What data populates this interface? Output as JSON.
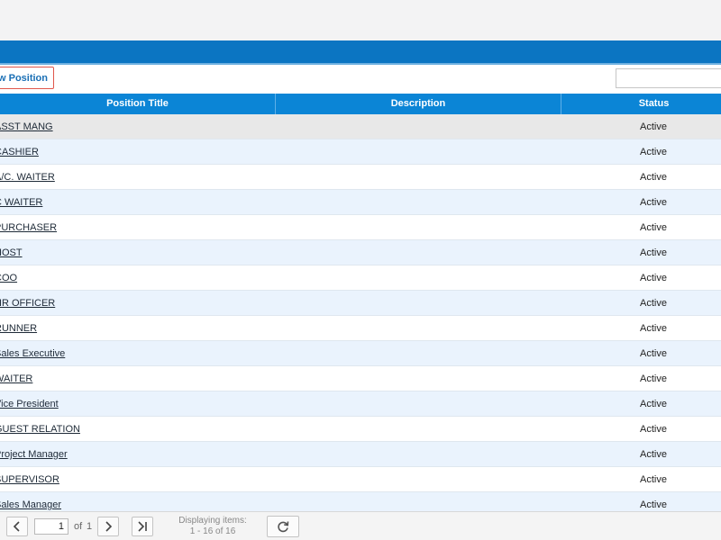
{
  "toolbar": {
    "new_position_label": "New Position"
  },
  "search": {
    "value": "",
    "placeholder": ""
  },
  "grid": {
    "columns": [
      "Position Title",
      "Description",
      "Status"
    ],
    "rows": [
      {
        "title": "ASST MANG",
        "description": "",
        "status": "Active"
      },
      {
        "title": "CASHIER",
        "description": "",
        "status": "Active"
      },
      {
        "title": "A/C. WAITER",
        "description": "",
        "status": "Active"
      },
      {
        "title": "C WAITER",
        "description": "",
        "status": "Active"
      },
      {
        "title": "PURCHASER",
        "description": "",
        "status": "Active"
      },
      {
        "title": "HOST",
        "description": "",
        "status": "Active"
      },
      {
        "title": "COO",
        "description": "",
        "status": "Active"
      },
      {
        "title": "HR OFFICER",
        "description": "",
        "status": "Active"
      },
      {
        "title": "RUNNER",
        "description": "",
        "status": "Active"
      },
      {
        "title": "Sales Executive",
        "description": "",
        "status": "Active"
      },
      {
        "title": "WAITER",
        "description": "",
        "status": "Active"
      },
      {
        "title": "Vice President",
        "description": "",
        "status": "Active"
      },
      {
        "title": "GUEST RELATION",
        "description": "",
        "status": "Active"
      },
      {
        "title": "Project Manager",
        "description": "",
        "status": "Active"
      },
      {
        "title": "SUPERVISOR",
        "description": "",
        "status": "Active"
      },
      {
        "title": "Sales Manager",
        "description": "",
        "status": "Active"
      }
    ]
  },
  "pager": {
    "current_page": "1",
    "of_label": "of",
    "total_pages": "1",
    "display_line1": "Displaying items:",
    "display_line2": "1 - 16 of 16",
    "icons": [
      "chevron-left-icon",
      "chevron-right-icon",
      "last-page-icon",
      "refresh-icon"
    ]
  },
  "colors": {
    "header_bar": "#0b75c2",
    "grid_header": "#0b85d6",
    "row_alt": "#eaf3fd",
    "highlight_border": "#e0564b"
  }
}
